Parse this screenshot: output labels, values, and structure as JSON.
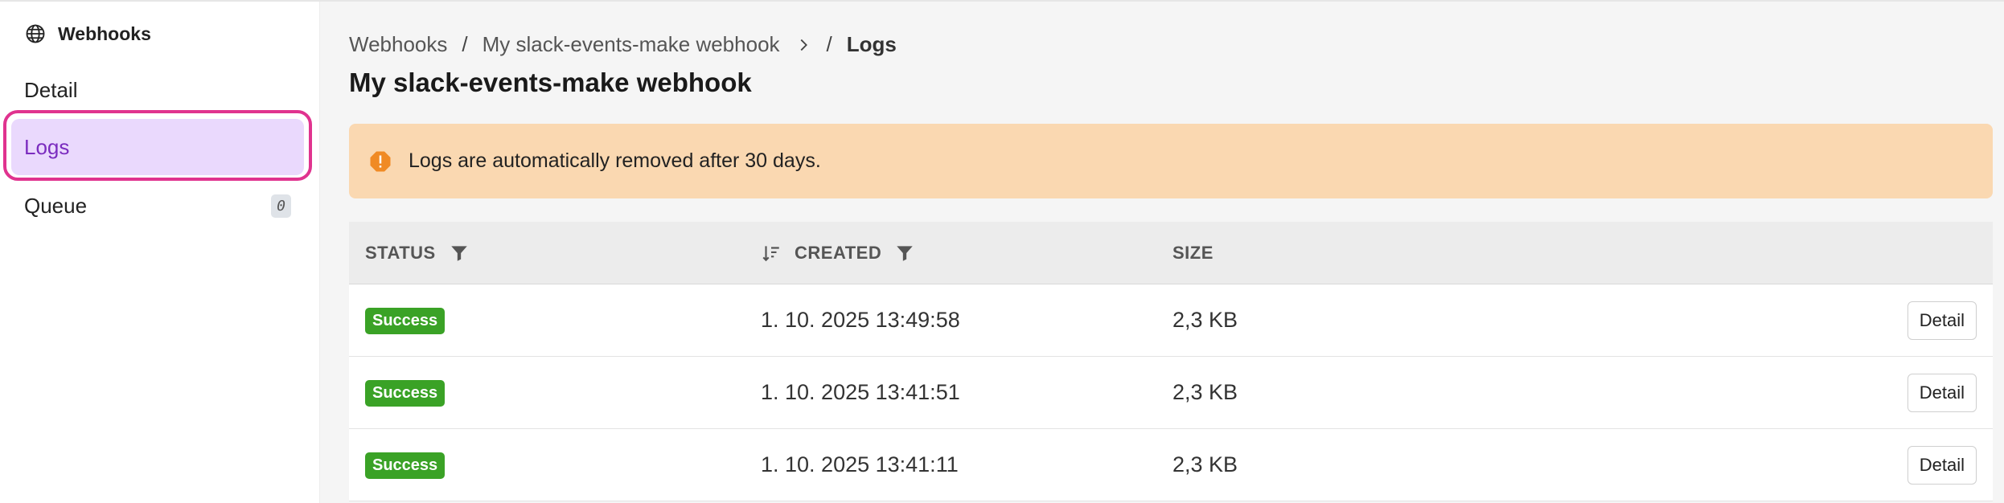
{
  "sidebar": {
    "header": {
      "icon": "globe-icon",
      "label": "Webhooks"
    },
    "items": [
      {
        "label": "Detail"
      },
      {
        "label": "Logs"
      },
      {
        "label": "Queue",
        "count": "0"
      }
    ]
  },
  "breadcrumb": {
    "root": "Webhooks",
    "webhook": "My slack-events-make webhook",
    "current": "Logs"
  },
  "page": {
    "title": "My slack-events-make webhook"
  },
  "alert": {
    "icon": "warning-icon",
    "text": "Logs are automatically removed after 30 days."
  },
  "table": {
    "columns": {
      "status": "STATUS",
      "created": "CREATED",
      "size": "SIZE"
    },
    "rows": [
      {
        "status": "Success",
        "created": "1. 10. 2025 13:49:58",
        "size": "2,3 KB",
        "action": "Detail"
      },
      {
        "status": "Success",
        "created": "1. 10. 2025 13:41:51",
        "size": "2,3 KB",
        "action": "Detail"
      },
      {
        "status": "Success",
        "created": "1. 10. 2025 13:41:11",
        "size": "2,3 KB",
        "action": "Detail"
      }
    ]
  },
  "colors": {
    "accent": "#7b2cbf",
    "active_bg": "#ead9fd",
    "highlight": "#e0338f",
    "alert_bg": "#fad8b1",
    "alert_icon": "#f08a24",
    "success": "#3aa226"
  }
}
